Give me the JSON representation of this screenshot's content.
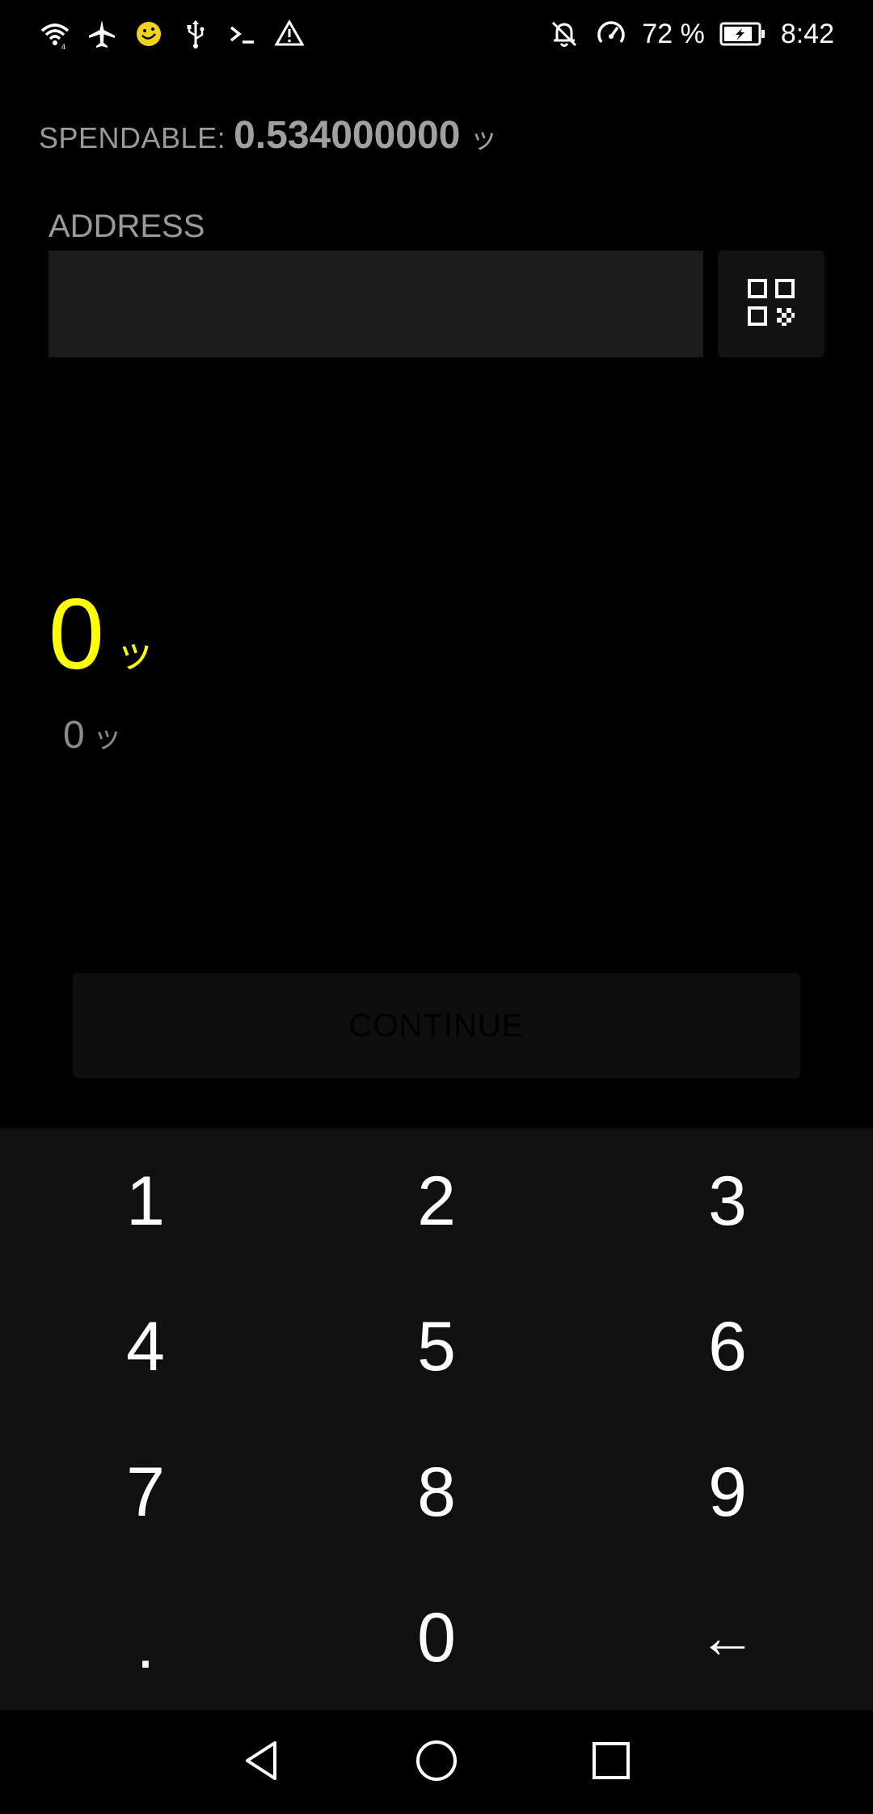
{
  "status_bar": {
    "battery_percent": "72 %",
    "time": "8:42",
    "icons_left": [
      "wifi-icon",
      "airplane-icon",
      "emoji-icon",
      "usb-icon",
      "terminal-icon",
      "warning-icon"
    ],
    "icons_right": [
      "bell-off-icon",
      "speedometer-icon",
      "battery-icon"
    ]
  },
  "spendable": {
    "label": "SPENDABLE:",
    "value": "0.534000000",
    "unit": "ッ"
  },
  "address": {
    "label": "ADDRESS",
    "value": "",
    "placeholder": ""
  },
  "qr_button": {
    "icon": "qr-code-icon"
  },
  "amount": {
    "primary_value": "0",
    "primary_unit": "ッ",
    "secondary_value": "0",
    "secondary_unit": "ッ"
  },
  "continue_button": {
    "label": "CONTINUE"
  },
  "keypad": {
    "keys": [
      "1",
      "2",
      "3",
      "4",
      "5",
      "6",
      "7",
      "8",
      "9",
      ".",
      "0",
      "←"
    ]
  },
  "nav_bar": {
    "icons": [
      "back-icon",
      "home-icon",
      "recents-icon"
    ]
  },
  "colors": {
    "accent": "#ffff00",
    "background": "#000000",
    "keypad_background": "#101010",
    "muted_text": "#9a9a9a"
  }
}
